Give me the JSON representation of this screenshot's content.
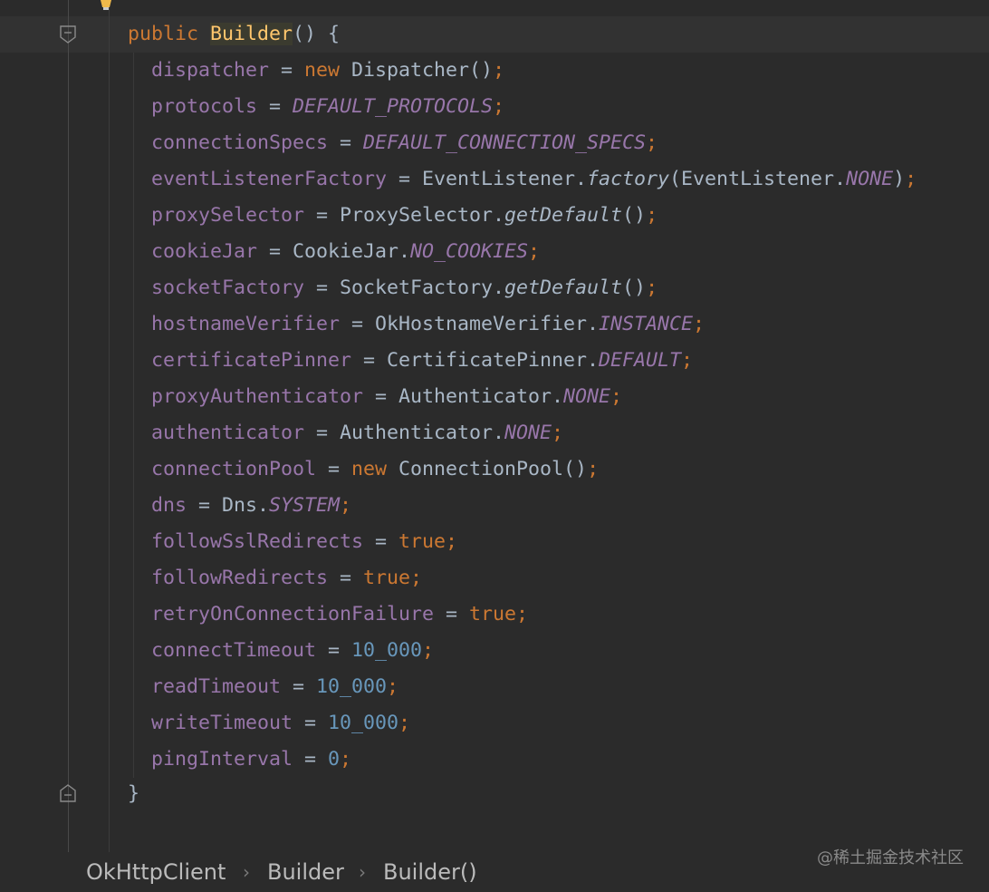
{
  "editor": {
    "lines": {
      "l00": [
        "public",
        "Builder",
        "() {"
      ],
      "l01": [
        "dispatcher",
        " = ",
        "new",
        " Dispatcher()",
        ";"
      ],
      "l02": [
        "protocols",
        " = ",
        "DEFAULT_PROTOCOLS",
        ";"
      ],
      "l03": [
        "connectionSpecs",
        " = ",
        "DEFAULT_CONNECTION_SPECS",
        ";"
      ],
      "l04": [
        "eventListenerFactory",
        " = EventListener.",
        "factory",
        "(EventListener.",
        "NONE",
        ")",
        ";"
      ],
      "l05": [
        "proxySelector",
        " = ProxySelector.",
        "getDefault",
        "()",
        ";"
      ],
      "l06": [
        "cookieJar",
        " = CookieJar.",
        "NO_COOKIES",
        ";"
      ],
      "l07": [
        "socketFactory",
        " = SocketFactory.",
        "getDefault",
        "()",
        ";"
      ],
      "l08": [
        "hostnameVerifier",
        " = OkHostnameVerifier.",
        "INSTANCE",
        ";"
      ],
      "l09": [
        "certificatePinner",
        " = CertificatePinner.",
        "DEFAULT",
        ";"
      ],
      "l10": [
        "proxyAuthenticator",
        " = Authenticator.",
        "NONE",
        ";"
      ],
      "l11": [
        "authenticator",
        " = Authenticator.",
        "NONE",
        ";"
      ],
      "l12": [
        "connectionPool",
        " = ",
        "new",
        " ConnectionPool()",
        ";"
      ],
      "l13": [
        "dns",
        " = Dns.",
        "SYSTEM",
        ";"
      ],
      "l14": [
        "followSslRedirects",
        " = ",
        "true",
        ";"
      ],
      "l15": [
        "followRedirects",
        " = ",
        "true",
        ";"
      ],
      "l16": [
        "retryOnConnectionFailure",
        " = ",
        "true",
        ";"
      ],
      "l17": [
        "connectTimeout",
        " = ",
        "10_000",
        ";"
      ],
      "l18": [
        "readTimeout",
        " = ",
        "10_000",
        ";"
      ],
      "l19": [
        "writeTimeout",
        " = ",
        "10_000",
        ";"
      ],
      "l20": [
        "pingInterval",
        " = ",
        "0",
        ";"
      ],
      "l21": [
        "}"
      ]
    },
    "icons": {
      "bulb": "lightbulb-icon",
      "fold": "fold-marker-icon"
    },
    "colors": {
      "background": "#2b2b2b",
      "keyword": "#cc7832",
      "field": "#9876aa",
      "number": "#6897bb",
      "method_highlight": "#ffc66d",
      "text": "#a9b7c6"
    }
  },
  "breadcrumb": {
    "items": [
      "OkHttpClient",
      "Builder",
      "Builder()"
    ],
    "separator": "›"
  },
  "watermark": "@稀土掘金技术社区"
}
